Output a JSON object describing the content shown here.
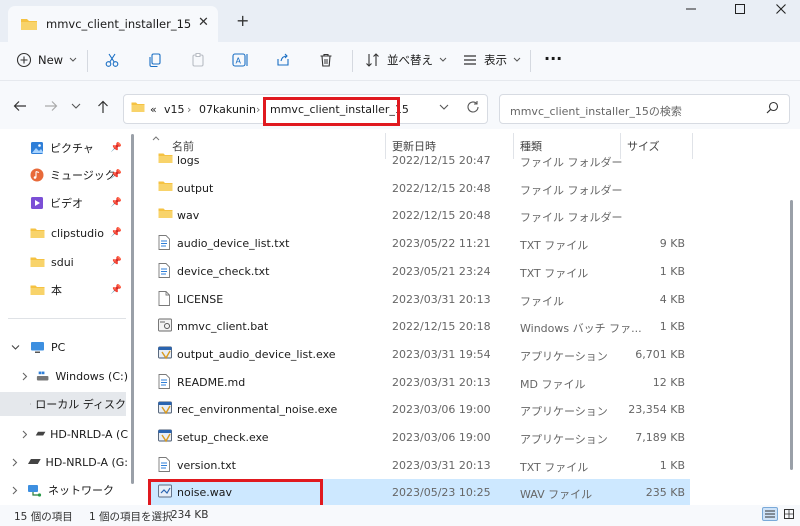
{
  "window": {
    "tab_title": "mmvc_client_installer_15",
    "close_tab": "✕",
    "new_tab": "+"
  },
  "toolbar": {
    "new_label": "New",
    "sort_label": "並べ替え",
    "view_label": "表示",
    "more_label": "···"
  },
  "address": {
    "overflow": "«",
    "crumbs": [
      "v15",
      "07kakunin",
      "mmvc_client_installer_15"
    ],
    "search_placeholder": "mmvc_client_installer_15の検索"
  },
  "sidebar": {
    "quick": [
      {
        "label": "ピクチャ",
        "icon": "pictures-icon"
      },
      {
        "label": "ミュージック",
        "icon": "music-icon"
      },
      {
        "label": "ビデオ",
        "icon": "video-icon"
      },
      {
        "label": "clipstudio",
        "icon": "folder-icon"
      },
      {
        "label": "sdui",
        "icon": "folder-icon"
      },
      {
        "label": "本",
        "icon": "folder-icon"
      }
    ],
    "pc": "PC",
    "drives": [
      "Windows (C:)",
      "ローカル ディスク",
      "HD-NRLD-A (C",
      "HD-NRLD-A (G:",
      "ネットワーク"
    ]
  },
  "columns": {
    "name": "名前",
    "date": "更新日時",
    "type": "種類",
    "size": "サイズ"
  },
  "files": [
    {
      "name": "logs",
      "date": "2022/12/15 20:47",
      "type": "ファイル フォルダー",
      "size": "",
      "icon": "folder-icon"
    },
    {
      "name": "output",
      "date": "2022/12/15 20:48",
      "type": "ファイル フォルダー",
      "size": "",
      "icon": "folder-icon"
    },
    {
      "name": "wav",
      "date": "2022/12/15 20:48",
      "type": "ファイル フォルダー",
      "size": "",
      "icon": "folder-icon"
    },
    {
      "name": "audio_device_list.txt",
      "date": "2023/05/22 11:21",
      "type": "TXT ファイル",
      "size": "9 KB",
      "icon": "text-file-icon"
    },
    {
      "name": "device_check.txt",
      "date": "2023/05/21 23:24",
      "type": "TXT ファイル",
      "size": "1 KB",
      "icon": "text-file-icon"
    },
    {
      "name": "LICENSE",
      "date": "2023/03/31 20:13",
      "type": "ファイル",
      "size": "4 KB",
      "icon": "blank-file-icon"
    },
    {
      "name": "mmvc_client.bat",
      "date": "2022/12/15 20:18",
      "type": "Windows バッチ ファ...",
      "size": "1 KB",
      "icon": "batch-file-icon"
    },
    {
      "name": "output_audio_device_list.exe",
      "date": "2023/03/31 19:54",
      "type": "アプリケーション",
      "size": "6,701 KB",
      "icon": "exe-file-icon"
    },
    {
      "name": "README.md",
      "date": "2023/03/31 20:13",
      "type": "MD ファイル",
      "size": "12 KB",
      "icon": "text-file-icon"
    },
    {
      "name": "rec_environmental_noise.exe",
      "date": "2023/03/06 19:00",
      "type": "アプリケーション",
      "size": "23,354 KB",
      "icon": "exe-file-icon"
    },
    {
      "name": "setup_check.exe",
      "date": "2023/03/06 19:00",
      "type": "アプリケーション",
      "size": "7,189 KB",
      "icon": "exe-file-icon"
    },
    {
      "name": "version.txt",
      "date": "2023/03/31 20:13",
      "type": "TXT ファイル",
      "size": "1 KB",
      "icon": "text-file-icon"
    },
    {
      "name": "noise.wav",
      "date": "2023/05/23 10:25",
      "type": "WAV ファイル",
      "size": "235 KB",
      "icon": "audio-file-icon"
    }
  ],
  "status": {
    "count": "15 個の項目",
    "selected": "1 個の項目を選択",
    "size": "234 KB"
  },
  "colors": {
    "highlight_box": "#e0191f",
    "selected_row": "#cde8ff",
    "folder": "#f5c242"
  }
}
